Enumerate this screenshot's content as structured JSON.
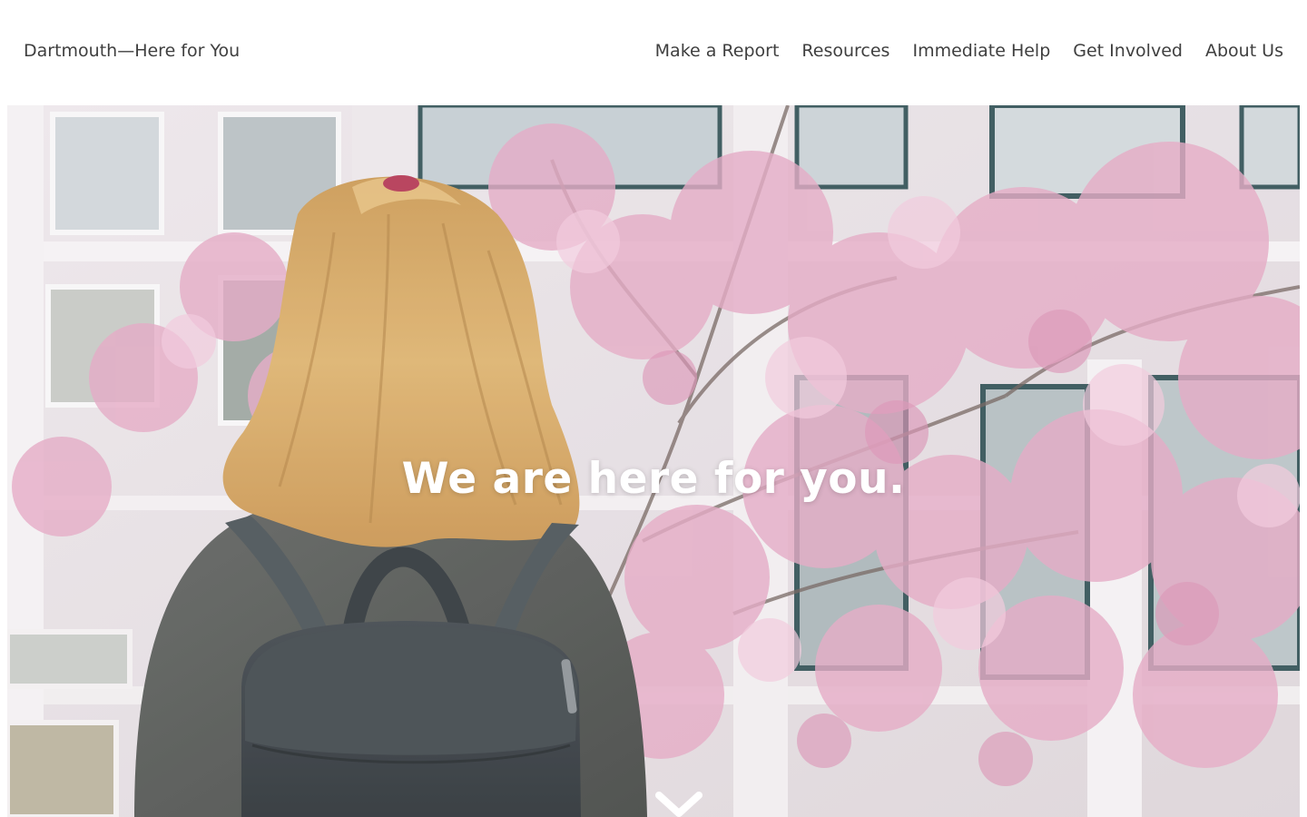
{
  "header": {
    "site_title": "Dartmouth—Here for You",
    "nav": [
      {
        "label": "Make a Report"
      },
      {
        "label": "Resources"
      },
      {
        "label": "Immediate Help"
      },
      {
        "label": "Get Involved"
      },
      {
        "label": "About Us"
      }
    ]
  },
  "hero": {
    "heading": "We are here for you.",
    "scroll_icon": "chevron-down-icon",
    "photo": "student with blonde ponytail and black backpack facing a building with pink blossoms"
  },
  "colors": {
    "nav_text": "#3f3f3f",
    "hero_text": "#ffffff",
    "blossom": "#e6a9c2"
  }
}
